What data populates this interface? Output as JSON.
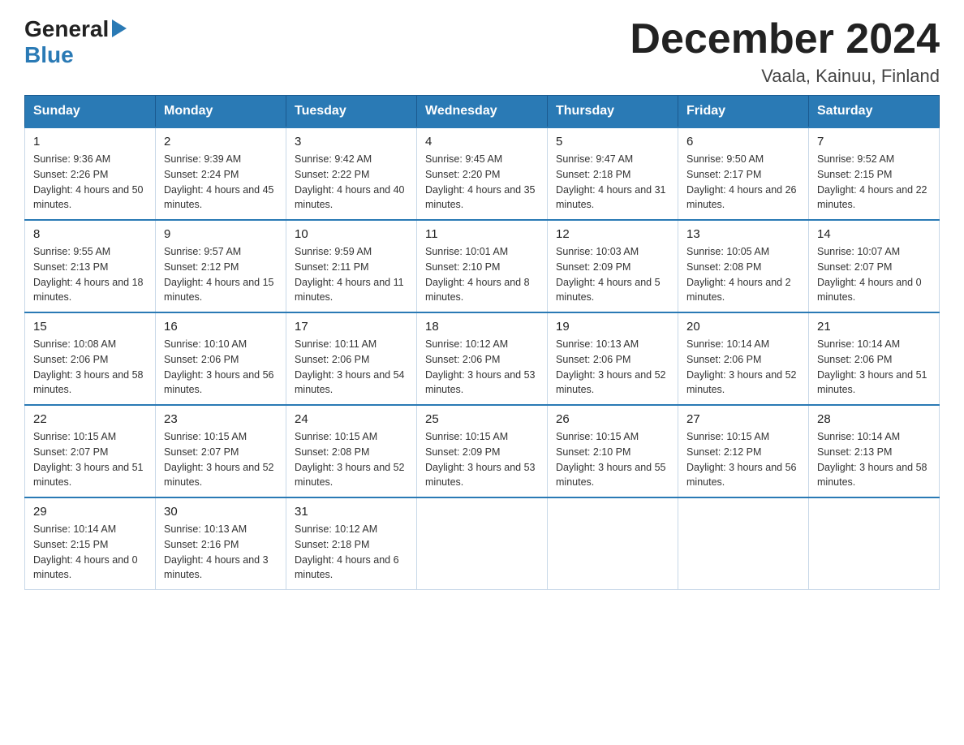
{
  "logo": {
    "general": "General",
    "blue": "Blue",
    "triangle": "▶"
  },
  "title": {
    "month_year": "December 2024",
    "location": "Vaala, Kainuu, Finland"
  },
  "weekdays": [
    "Sunday",
    "Monday",
    "Tuesday",
    "Wednesday",
    "Thursday",
    "Friday",
    "Saturday"
  ],
  "weeks": [
    [
      {
        "day": "1",
        "sunrise": "Sunrise: 9:36 AM",
        "sunset": "Sunset: 2:26 PM",
        "daylight": "Daylight: 4 hours and 50 minutes."
      },
      {
        "day": "2",
        "sunrise": "Sunrise: 9:39 AM",
        "sunset": "Sunset: 2:24 PM",
        "daylight": "Daylight: 4 hours and 45 minutes."
      },
      {
        "day": "3",
        "sunrise": "Sunrise: 9:42 AM",
        "sunset": "Sunset: 2:22 PM",
        "daylight": "Daylight: 4 hours and 40 minutes."
      },
      {
        "day": "4",
        "sunrise": "Sunrise: 9:45 AM",
        "sunset": "Sunset: 2:20 PM",
        "daylight": "Daylight: 4 hours and 35 minutes."
      },
      {
        "day": "5",
        "sunrise": "Sunrise: 9:47 AM",
        "sunset": "Sunset: 2:18 PM",
        "daylight": "Daylight: 4 hours and 31 minutes."
      },
      {
        "day": "6",
        "sunrise": "Sunrise: 9:50 AM",
        "sunset": "Sunset: 2:17 PM",
        "daylight": "Daylight: 4 hours and 26 minutes."
      },
      {
        "day": "7",
        "sunrise": "Sunrise: 9:52 AM",
        "sunset": "Sunset: 2:15 PM",
        "daylight": "Daylight: 4 hours and 22 minutes."
      }
    ],
    [
      {
        "day": "8",
        "sunrise": "Sunrise: 9:55 AM",
        "sunset": "Sunset: 2:13 PM",
        "daylight": "Daylight: 4 hours and 18 minutes."
      },
      {
        "day": "9",
        "sunrise": "Sunrise: 9:57 AM",
        "sunset": "Sunset: 2:12 PM",
        "daylight": "Daylight: 4 hours and 15 minutes."
      },
      {
        "day": "10",
        "sunrise": "Sunrise: 9:59 AM",
        "sunset": "Sunset: 2:11 PM",
        "daylight": "Daylight: 4 hours and 11 minutes."
      },
      {
        "day": "11",
        "sunrise": "Sunrise: 10:01 AM",
        "sunset": "Sunset: 2:10 PM",
        "daylight": "Daylight: 4 hours and 8 minutes."
      },
      {
        "day": "12",
        "sunrise": "Sunrise: 10:03 AM",
        "sunset": "Sunset: 2:09 PM",
        "daylight": "Daylight: 4 hours and 5 minutes."
      },
      {
        "day": "13",
        "sunrise": "Sunrise: 10:05 AM",
        "sunset": "Sunset: 2:08 PM",
        "daylight": "Daylight: 4 hours and 2 minutes."
      },
      {
        "day": "14",
        "sunrise": "Sunrise: 10:07 AM",
        "sunset": "Sunset: 2:07 PM",
        "daylight": "Daylight: 4 hours and 0 minutes."
      }
    ],
    [
      {
        "day": "15",
        "sunrise": "Sunrise: 10:08 AM",
        "sunset": "Sunset: 2:06 PM",
        "daylight": "Daylight: 3 hours and 58 minutes."
      },
      {
        "day": "16",
        "sunrise": "Sunrise: 10:10 AM",
        "sunset": "Sunset: 2:06 PM",
        "daylight": "Daylight: 3 hours and 56 minutes."
      },
      {
        "day": "17",
        "sunrise": "Sunrise: 10:11 AM",
        "sunset": "Sunset: 2:06 PM",
        "daylight": "Daylight: 3 hours and 54 minutes."
      },
      {
        "day": "18",
        "sunrise": "Sunrise: 10:12 AM",
        "sunset": "Sunset: 2:06 PM",
        "daylight": "Daylight: 3 hours and 53 minutes."
      },
      {
        "day": "19",
        "sunrise": "Sunrise: 10:13 AM",
        "sunset": "Sunset: 2:06 PM",
        "daylight": "Daylight: 3 hours and 52 minutes."
      },
      {
        "day": "20",
        "sunrise": "Sunrise: 10:14 AM",
        "sunset": "Sunset: 2:06 PM",
        "daylight": "Daylight: 3 hours and 52 minutes."
      },
      {
        "day": "21",
        "sunrise": "Sunrise: 10:14 AM",
        "sunset": "Sunset: 2:06 PM",
        "daylight": "Daylight: 3 hours and 51 minutes."
      }
    ],
    [
      {
        "day": "22",
        "sunrise": "Sunrise: 10:15 AM",
        "sunset": "Sunset: 2:07 PM",
        "daylight": "Daylight: 3 hours and 51 minutes."
      },
      {
        "day": "23",
        "sunrise": "Sunrise: 10:15 AM",
        "sunset": "Sunset: 2:07 PM",
        "daylight": "Daylight: 3 hours and 52 minutes."
      },
      {
        "day": "24",
        "sunrise": "Sunrise: 10:15 AM",
        "sunset": "Sunset: 2:08 PM",
        "daylight": "Daylight: 3 hours and 52 minutes."
      },
      {
        "day": "25",
        "sunrise": "Sunrise: 10:15 AM",
        "sunset": "Sunset: 2:09 PM",
        "daylight": "Daylight: 3 hours and 53 minutes."
      },
      {
        "day": "26",
        "sunrise": "Sunrise: 10:15 AM",
        "sunset": "Sunset: 2:10 PM",
        "daylight": "Daylight: 3 hours and 55 minutes."
      },
      {
        "day": "27",
        "sunrise": "Sunrise: 10:15 AM",
        "sunset": "Sunset: 2:12 PM",
        "daylight": "Daylight: 3 hours and 56 minutes."
      },
      {
        "day": "28",
        "sunrise": "Sunrise: 10:14 AM",
        "sunset": "Sunset: 2:13 PM",
        "daylight": "Daylight: 3 hours and 58 minutes."
      }
    ],
    [
      {
        "day": "29",
        "sunrise": "Sunrise: 10:14 AM",
        "sunset": "Sunset: 2:15 PM",
        "daylight": "Daylight: 4 hours and 0 minutes."
      },
      {
        "day": "30",
        "sunrise": "Sunrise: 10:13 AM",
        "sunset": "Sunset: 2:16 PM",
        "daylight": "Daylight: 4 hours and 3 minutes."
      },
      {
        "day": "31",
        "sunrise": "Sunrise: 10:12 AM",
        "sunset": "Sunset: 2:18 PM",
        "daylight": "Daylight: 4 hours and 6 minutes."
      },
      null,
      null,
      null,
      null
    ]
  ]
}
